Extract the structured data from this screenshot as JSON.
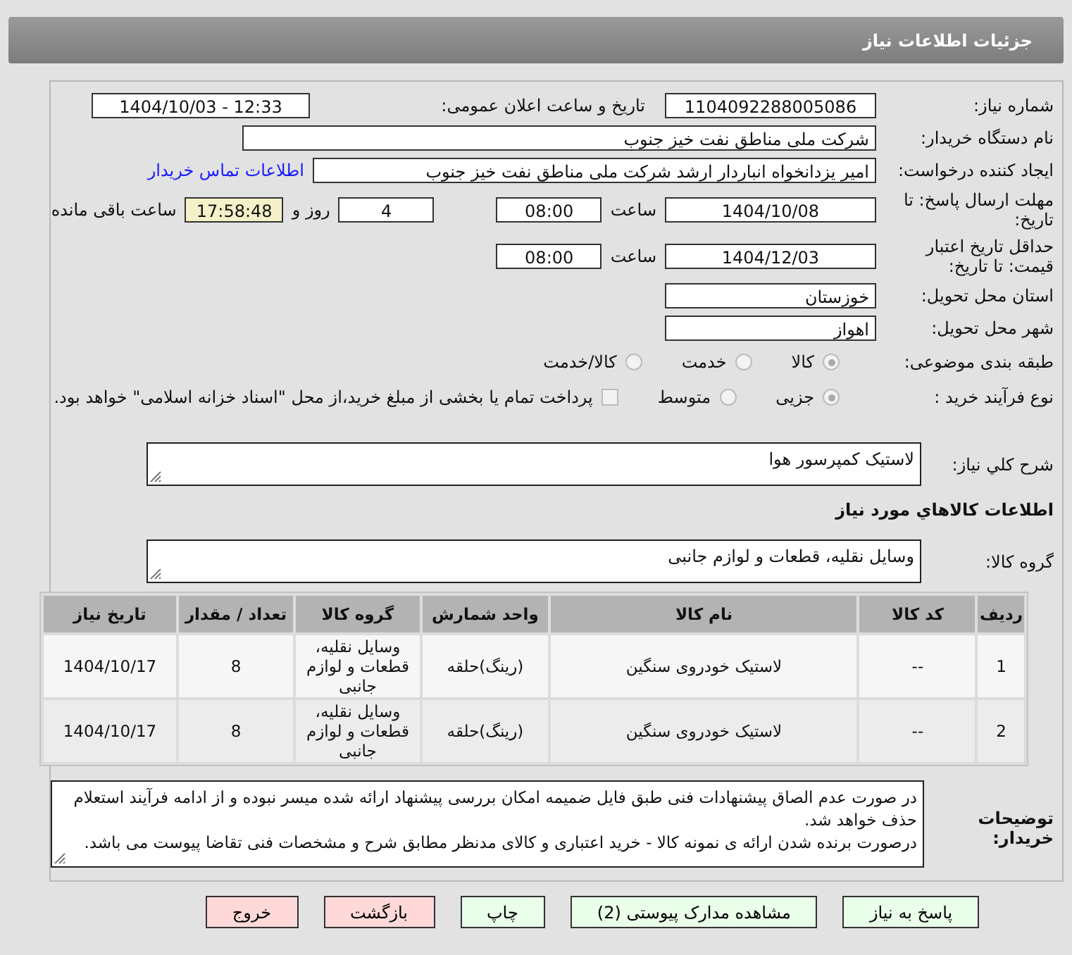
{
  "header": {
    "title": "جزئیات اطلاعات نیاز"
  },
  "need_number": {
    "label": "شماره نیاز:",
    "value": "1104092288005086"
  },
  "announce": {
    "label": "تاریخ و ساعت اعلان عمومی:",
    "value": "1404/10/03 - 12:33"
  },
  "buyer_org": {
    "label": "نام دستگاه خریدار:",
    "value": "شرکت ملی مناطق نفت خیز جنوب"
  },
  "requester": {
    "label": "ایجاد کننده درخواست:",
    "value": "امیر یزدانخواه انباردار ارشد شرکت ملی مناطق نفت خیز جنوب",
    "link": "اطلاعات تماس خریدار"
  },
  "reply_deadline": {
    "label": "مهلت ارسال پاسخ: تا تاریخ:",
    "date": "1404/10/08",
    "time_label": "ساعت",
    "time": "08:00",
    "days": "4",
    "days_label": "روز و",
    "remaining": "17:58:48",
    "remaining_label": "ساعت باقی مانده"
  },
  "price_validity": {
    "label": "حداقل تاریخ اعتبار قیمت: تا تاریخ:",
    "date": "1404/12/03",
    "time_label": "ساعت",
    "time": "08:00"
  },
  "province": {
    "label": "استان محل تحویل:",
    "value": "خوزستان"
  },
  "city": {
    "label": "شهر محل تحویل:",
    "value": "اهواز"
  },
  "category": {
    "label": "طبقه بندی موضوعی:",
    "options": [
      {
        "label": "کالا",
        "selected": true
      },
      {
        "label": "خدمت",
        "selected": false
      },
      {
        "label": "کالا/خدمت",
        "selected": false
      }
    ]
  },
  "process": {
    "label": "نوع فرآیند خرید :",
    "options": [
      {
        "label": "جزیی",
        "selected": true
      },
      {
        "label": "متوسط",
        "selected": false
      }
    ],
    "payment": {
      "checked": false,
      "label": "پرداخت تمام یا بخشی از مبلغ خرید،از محل \"اسناد خزانه اسلامی\" خواهد بود."
    }
  },
  "description": {
    "label": "شرح کلي نياز:",
    "value": "لاستیک کمپرسور هوا"
  },
  "goods_heading": "اطلاعات کالاهاي مورد نياز",
  "goods_group": {
    "label": "گروه کالا:",
    "value": "وسایل نقلیه، قطعات و لوازم جانبی"
  },
  "table": {
    "columns": [
      "ردیف",
      "کد کالا",
      "نام کالا",
      "واحد شمارش",
      "گروه کالا",
      "تعداد / مقدار",
      "تاریخ نیاز"
    ],
    "rows": [
      [
        "1",
        "--",
        "لاستیک خودروی سنگین",
        "(رینگ)حلقه",
        "وسایل نقلیه، قطعات و لوازم جانبی",
        "8",
        "1404/10/17"
      ],
      [
        "2",
        "--",
        "لاستیک خودروی سنگین",
        "(رینگ)حلقه",
        "وسایل نقلیه، قطعات و لوازم جانبی",
        "8",
        "1404/10/17"
      ]
    ]
  },
  "buyer_notes": {
    "label": "توضیحات خریدار:",
    "value": "در صورت عدم الصاق پیشنهادات فنی طبق فایل ضمیمه امکان بررسی پیشنهاد ارائه شده میسر نبوده و از ادامه فرآیند استعلام حذف خواهد شد.\nدرصورت برنده شدن ارائه ی نمونه کالا - خرید اعتباری و کالای مدنظر مطابق شرح و مشخصات فنی تقاضا پیوست می باشد."
  },
  "buttons": [
    {
      "label": "پاسخ به نیاز",
      "color": "#eaffea"
    },
    {
      "label": "مشاهده مدارک پیوستی (2)",
      "color": "#eaffea"
    },
    {
      "label": "چاپ",
      "color": "#eaffea"
    },
    {
      "label": "بازگشت",
      "color": "#ffd9d9"
    },
    {
      "label": "خروج",
      "color": "#ffd9d9"
    }
  ]
}
